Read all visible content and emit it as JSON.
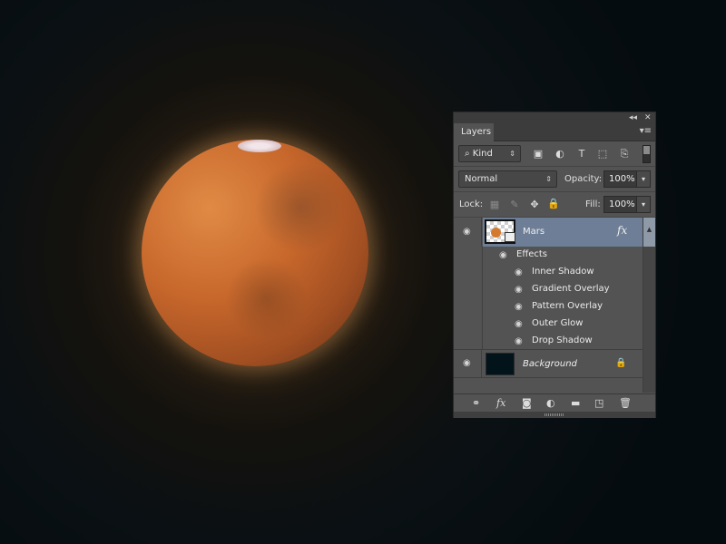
{
  "canvas": {
    "subject": "Mars",
    "background_color": "#03131a"
  },
  "panel": {
    "collapse_label": "◂◂",
    "close_label": "✕",
    "tab_label": "Layers",
    "menu_label": "▾≡",
    "filter": {
      "kind_label": "Kind",
      "search_icon": "⌕",
      "arrows": "⇕"
    },
    "filter_icons": {
      "image": "▣",
      "adjustment": "◐",
      "type": "T",
      "shape": "⬚",
      "smart": "⎘"
    },
    "blend_mode": "Normal",
    "blend_arrows": "⇕",
    "opacity_label": "Opacity:",
    "opacity_value": "100%",
    "lock_label": "Lock:",
    "lock_icons": {
      "transparent": "▦",
      "paint": "✎",
      "move": "✥",
      "all": "🔒"
    },
    "fill_label": "Fill:",
    "fill_value": "100%",
    "dropdown_arrow": "▾",
    "layers": [
      {
        "name": "Mars",
        "selected": true,
        "visible": true,
        "fx": "fx",
        "effects_label": "Effects",
        "effects": [
          "Inner Shadow",
          "Gradient Overlay",
          "Pattern Overlay",
          "Outer Glow",
          "Drop Shadow"
        ]
      },
      {
        "name": "Background",
        "selected": false,
        "visible": true,
        "locked": true
      }
    ],
    "eye_icon": "◉",
    "lock_icon": "🔒",
    "scroll_up": "▲",
    "footer_icons": {
      "link": "⚭",
      "fx": "fx",
      "mask": "◙",
      "adjustment": "◐",
      "group": "▬",
      "new_layer": "◳",
      "delete": "🗑"
    },
    "accent_selected": "#6d7e96"
  }
}
